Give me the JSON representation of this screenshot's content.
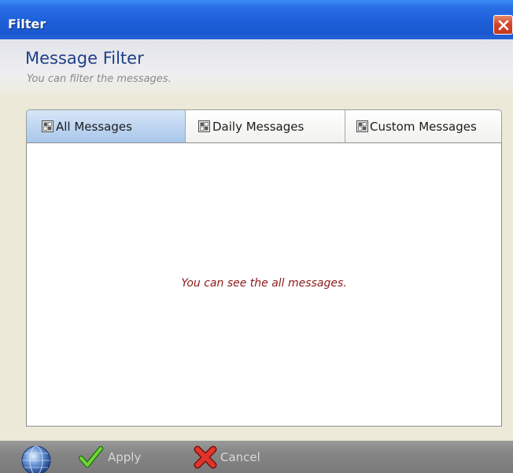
{
  "window": {
    "title": "Filter"
  },
  "header": {
    "title": "Message Filter",
    "subtitle": "You can filter the messages."
  },
  "tabs": [
    {
      "label": "All Messages",
      "icon": "tab-grid-icon",
      "active": true
    },
    {
      "label": "Daily Messages",
      "icon": "tab-grid-icon",
      "active": false
    },
    {
      "label": "Custom Messages",
      "icon": "tab-grid-icon",
      "active": false
    }
  ],
  "content": {
    "message": "You can see the all messages."
  },
  "footer": {
    "apply_label": "Apply",
    "cancel_label": "Cancel",
    "globe_icon": "globe-icon",
    "apply_icon": "checkmark-icon",
    "cancel_icon": "x-icon"
  },
  "colors": {
    "titlebar": "#1d5fd8",
    "header_title": "#1f3f8a",
    "message": "#8b1b1b",
    "active_tab": "#bcd4f0"
  }
}
